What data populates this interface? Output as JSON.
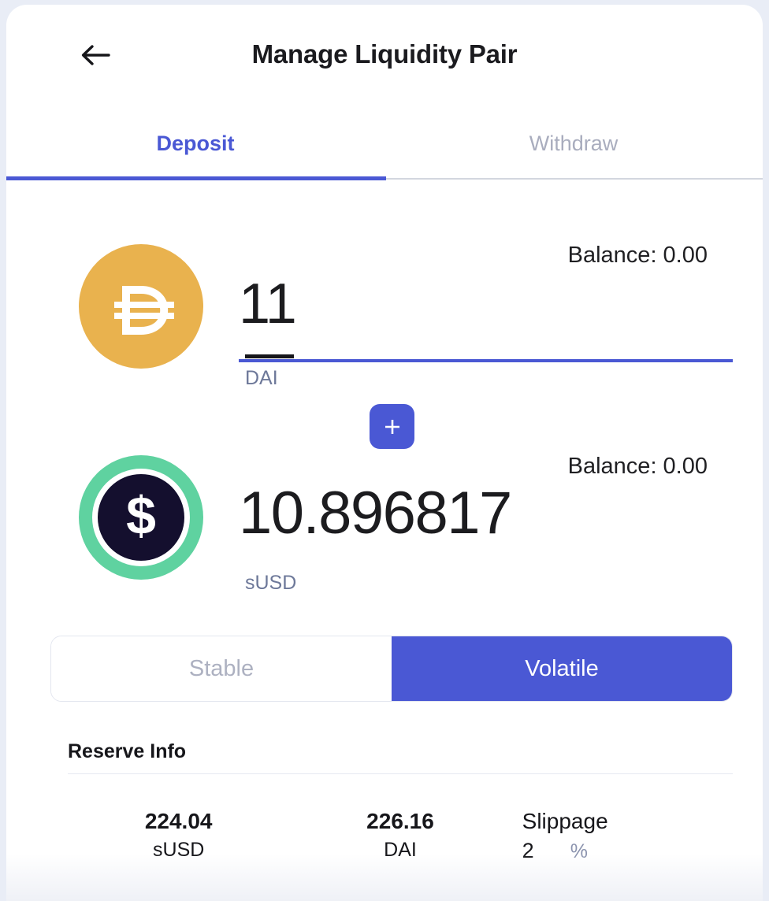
{
  "header": {
    "title": "Manage Liquidity Pair",
    "back_icon": "arrow-left-icon"
  },
  "tabs": [
    {
      "label": "Deposit",
      "active": true
    },
    {
      "label": "Withdraw",
      "active": false
    }
  ],
  "deposit": {
    "add_button_icon": "plus-icon",
    "inputs": [
      {
        "icon": "dai-coin-icon",
        "balance_label": "Balance: 0.00",
        "amount": "11",
        "token": "DAI"
      },
      {
        "icon": "susd-coin-icon",
        "balance_label": "Balance: 0.00",
        "amount": "10.896817",
        "token": "sUSD"
      }
    ]
  },
  "pool_type": {
    "options": [
      {
        "label": "Stable",
        "selected": false
      },
      {
        "label": "Volatile",
        "selected": true
      }
    ]
  },
  "reserve_info": {
    "title": "Reserve Info",
    "stats": [
      {
        "value": "224.04",
        "label": "sUSD"
      },
      {
        "value": "226.16",
        "label": "DAI"
      }
    ],
    "slippage": {
      "title": "Slippage",
      "value": "2",
      "unit": "%"
    }
  },
  "colors": {
    "accent": "#4a58d4",
    "dai": "#e9b24e",
    "susd_ring": "#5fd2a0",
    "susd_core": "#140f2e",
    "muted": "#6d7899",
    "page_bg": "#e9edf6"
  }
}
